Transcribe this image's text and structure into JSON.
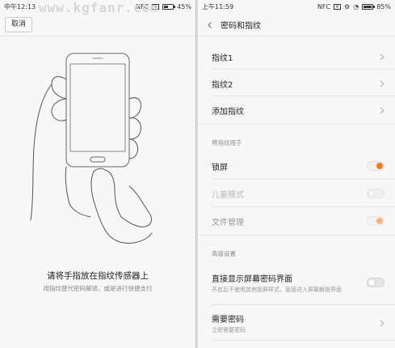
{
  "watermark": "www.kgfanr.com",
  "left": {
    "status": {
      "time": "中午12:13",
      "nfc": "NFC",
      "battery": "45%",
      "battery_level": 0.45
    },
    "cancel_label": "取消",
    "title": "请将手指放在指纹传感器上",
    "subtitle": "用指纹替代密码解锁，或是进行快捷支付"
  },
  "right": {
    "status": {
      "time": "上午11:59",
      "nfc": "NFC",
      "battery": "85%",
      "battery_level": 0.85
    },
    "header_title": "密码和指纹",
    "items": [
      {
        "label": "指纹1"
      },
      {
        "label": "指纹2"
      },
      {
        "label": "添加指纹"
      }
    ],
    "section_usage": "将指纹用于",
    "usage": [
      {
        "label": "锁屏",
        "state": "on"
      },
      {
        "label": "儿童模式",
        "state": "disabled"
      },
      {
        "label": "文件管理",
        "state": "on-dim"
      }
    ],
    "section_advanced": "高级设置",
    "advanced": [
      {
        "label": "直接显示屏幕密码界面",
        "sub": "开启后不使用其他锁屏样式，直接进入屏幕解锁界面"
      },
      {
        "label": "需要密码",
        "sub": "立即需要密码"
      }
    ]
  },
  "colors": {
    "accent": "#f07e1c",
    "background": "#f7f7f7"
  }
}
